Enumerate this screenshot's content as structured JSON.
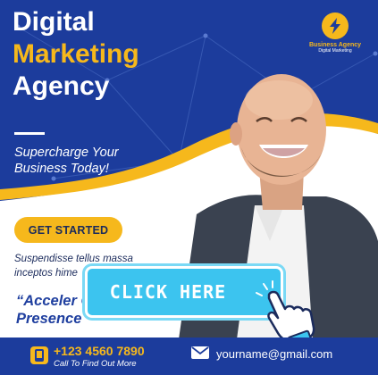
{
  "headline": {
    "line1": "Digital",
    "line2": "Marketing",
    "line3": "Agency"
  },
  "tagline": "Supercharge Your Business Today!",
  "cta_label": "GET STARTED",
  "body_text": "Suspendisse tellus massa inceptos hime",
  "quote": "“Acceler Online Presence",
  "logo": {
    "name": "Business Agency",
    "subtitle": "Digital Marketing",
    "icon": "lightning-bolt-icon"
  },
  "click_button": {
    "label": "CLICK HERE",
    "icon": "pointing-hand-cursor-icon"
  },
  "contact": {
    "phone": "+123 4560 7890",
    "phone_caption": "Call To Find Out More",
    "phone_icon": "phone-icon",
    "email": "yourname@gmail.com",
    "email_icon": "mail-icon"
  },
  "colors": {
    "primary_blue": "#1c3c9c",
    "accent_yellow": "#f6b81c",
    "click_cyan": "#3cc4ef"
  }
}
